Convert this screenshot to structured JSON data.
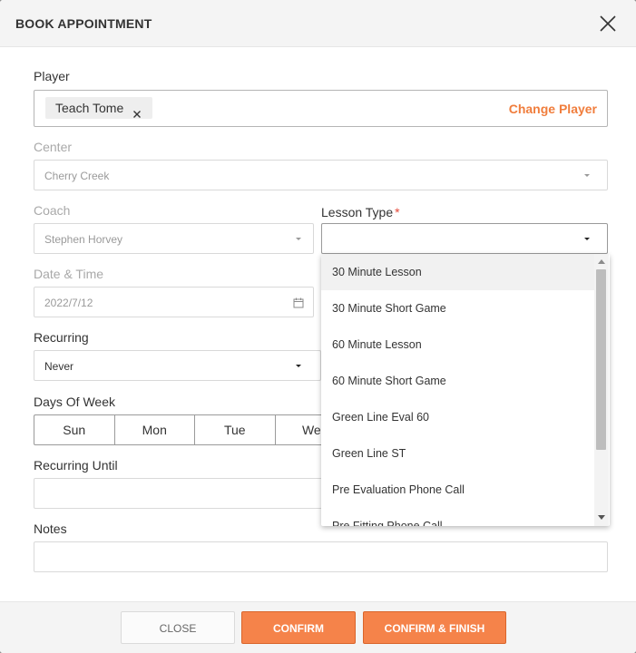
{
  "header": {
    "title": "BOOK APPOINTMENT"
  },
  "player": {
    "label": "Player",
    "tag": "Teach Tome",
    "change_label": "Change Player"
  },
  "center": {
    "label": "Center",
    "value": "Cherry Creek"
  },
  "coach": {
    "label": "Coach",
    "value": "Stephen Horvey"
  },
  "lesson_type": {
    "label": "Lesson Type",
    "required_mark": "*",
    "value": ""
  },
  "date_time": {
    "label": "Date & Time",
    "value": "2022/7/12"
  },
  "recurring": {
    "label": "Recurring",
    "value": "Never"
  },
  "days_of_week": {
    "label": "Days Of Week",
    "days": [
      "Sun",
      "Mon",
      "Tue",
      "Wed"
    ]
  },
  "recurring_until": {
    "label": "Recurring Until",
    "value": ""
  },
  "notes": {
    "label": "Notes",
    "value": ""
  },
  "lesson_options": [
    "30 Minute Lesson",
    "30 Minute Short Game",
    "60 Minute Lesson",
    "60 Minute Short Game",
    "Green Line Eval 60",
    "Green Line ST",
    "Pre Evaluation Phone Call",
    "Pre Fitting Phone Call"
  ],
  "footer": {
    "close": "CLOSE",
    "confirm": "CONFIRM",
    "confirm_finish": "CONFIRM & FINISH"
  },
  "colors": {
    "accent": "#f5834a",
    "link": "#f07d3c",
    "required": "#e5493a"
  }
}
